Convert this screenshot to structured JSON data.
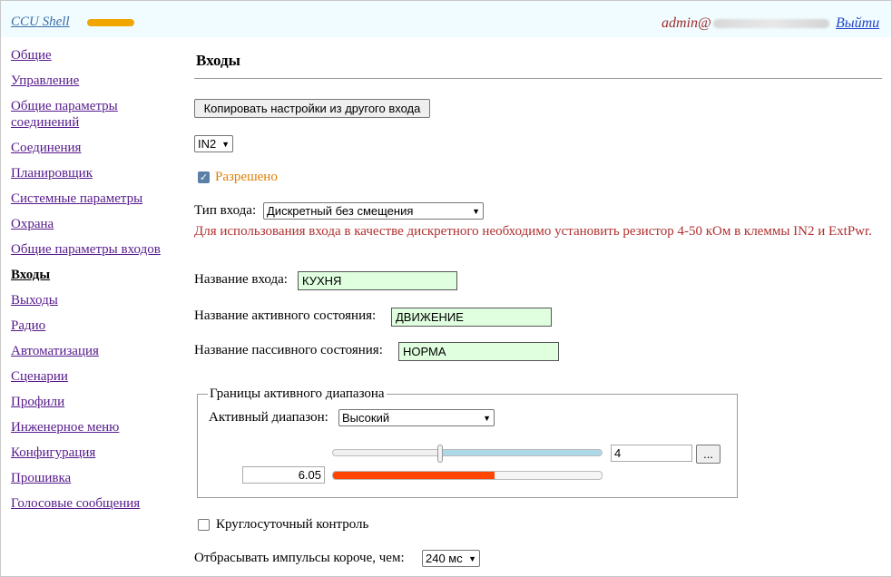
{
  "header": {
    "app_name": "CCU Shell",
    "user": "admin@",
    "logout_label": "Выйти"
  },
  "sidebar": {
    "items": [
      {
        "label": "Общие"
      },
      {
        "label": "Управление"
      },
      {
        "label": "Общие параметры соединений"
      },
      {
        "label": "Соединения"
      },
      {
        "label": "Планировщик"
      },
      {
        "label": "Системные параметры"
      },
      {
        "label": "Охрана"
      },
      {
        "label": "Общие параметры входов"
      },
      {
        "label": "Входы",
        "active": true
      },
      {
        "label": "Выходы"
      },
      {
        "label": "Радио"
      },
      {
        "label": "Автоматизация"
      },
      {
        "label": "Сценарии"
      },
      {
        "label": "Профили"
      },
      {
        "label": "Инженерное меню"
      },
      {
        "label": "Конфигурация"
      },
      {
        "label": "Прошивка"
      },
      {
        "label": "Голосовые сообщения"
      }
    ]
  },
  "main": {
    "title": "Входы",
    "copy_button": "Копировать настройки из другого входа",
    "input_select": "IN2",
    "enabled_label": "Разрешено",
    "enabled": true,
    "type_label": "Тип входа:",
    "type_value": "Дискретный без смещения",
    "warning": "Для использования входа в качестве дискретного необходимо установить резистор 4-50 кОм в клеммы IN2 и ExtPwr.",
    "name_label": "Название входа:",
    "name_value": "КУХНЯ",
    "active_state_label": "Название активного состояния:",
    "active_state_value": "ДВИЖЕНИЕ",
    "passive_state_label": "Название пассивного состояния:",
    "passive_state_value": "НОРМА",
    "range_group": {
      "legend": "Границы активного диапазона",
      "range_label": "Активный диапазон:",
      "range_value": "Высокий",
      "threshold": "4",
      "threshold_fraction": 0.4,
      "more_button": "...",
      "current_value": "6.05",
      "current_fraction": 0.6
    },
    "h24_label": "Круглосуточный контроль",
    "h24_checked": false,
    "pulse_label": "Отбрасывать импульсы короче, чем:",
    "pulse_value": "240 мс"
  },
  "colors": {
    "accent_progress": "#f0a500",
    "enabled_text": "#e08000",
    "warning_text": "#b03030",
    "level_fill": "#ff4500",
    "slider_fill": "#add8e6",
    "field_bg": "#dfffdf"
  }
}
